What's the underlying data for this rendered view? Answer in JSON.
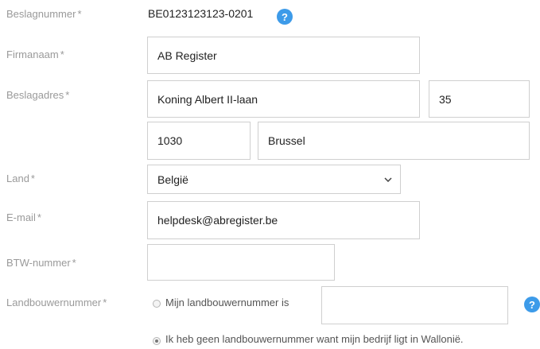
{
  "form": {
    "beslagnummer": {
      "label": "Beslagnummer",
      "value": "BE0123123123-0201"
    },
    "firmanaam": {
      "label": "Firmanaam",
      "value": "AB Register"
    },
    "beslagadres": {
      "label": "Beslagadres",
      "street": "Koning Albert II-laan",
      "number": "35",
      "postcode": "1030",
      "city": "Brussel"
    },
    "land": {
      "label": "Land",
      "value": "België"
    },
    "email": {
      "label": "E-mail",
      "value": "helpdesk@abregister.be"
    },
    "btw": {
      "label": "BTW-nummer",
      "value": ""
    },
    "landbouw": {
      "label": "Landbouwernummer",
      "option_has": "Mijn landbouwernummer is",
      "option_has_value": "",
      "option_none": "Ik heb geen landbouwernummer want mijn bedrijf ligt in Wallonië.",
      "selected": "option_none"
    },
    "required_marker": "*",
    "help_glyph": "?"
  },
  "icons": {
    "help": "help-icon",
    "select": "chevron-down-icon"
  },
  "colors": {
    "help_bg": "#3d9be9",
    "label": "#9a9a9a",
    "border": "#cfcfcf"
  }
}
